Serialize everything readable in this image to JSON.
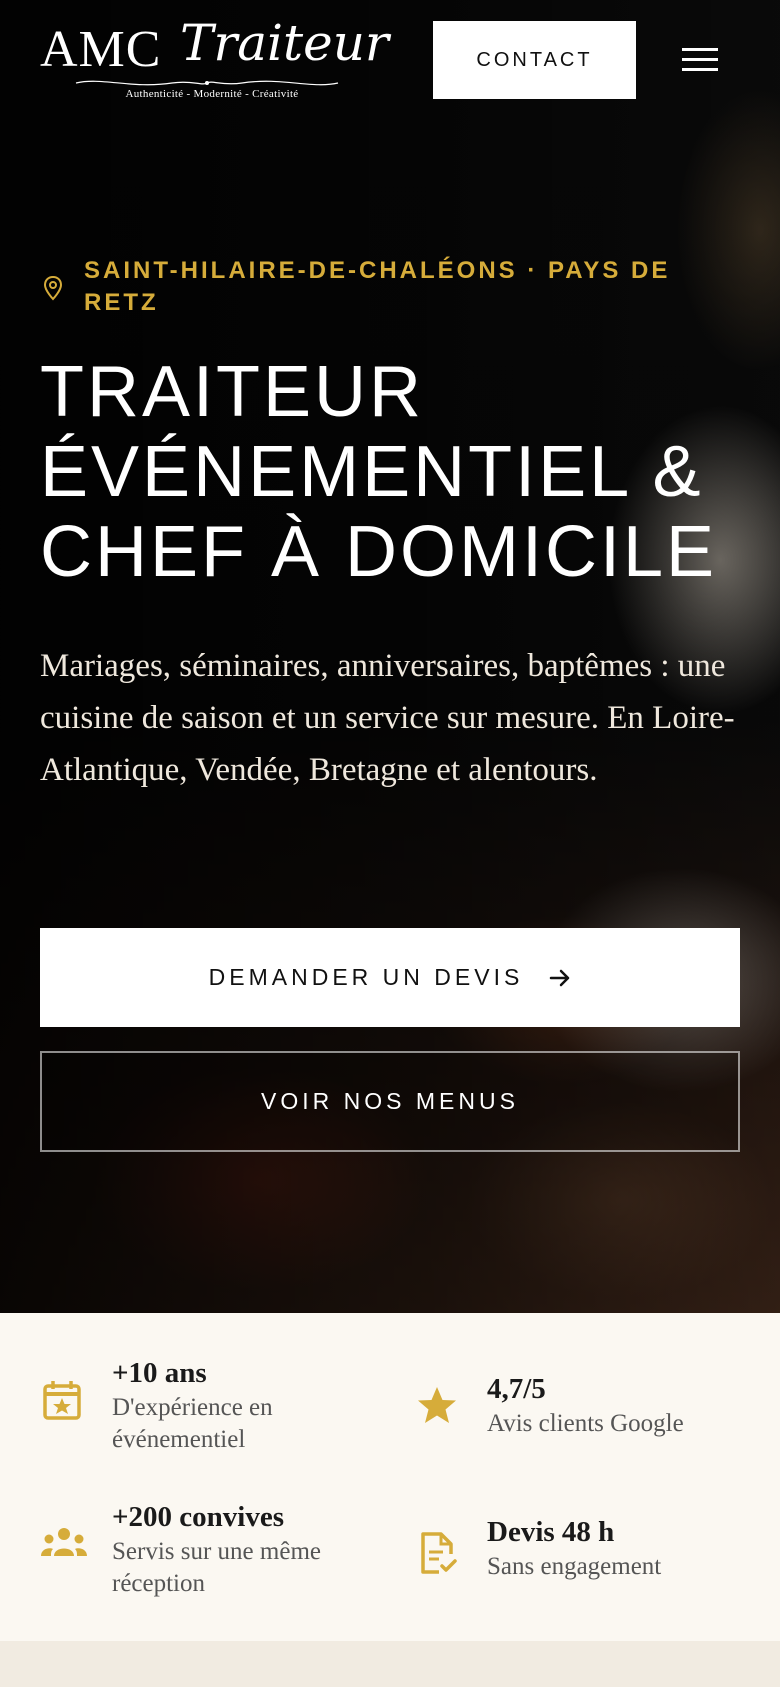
{
  "header": {
    "logo": {
      "brand": "AMC",
      "name": "Traiteur",
      "tagline": "Authenticité - Modernité - Créativité"
    },
    "contact_label": "CONTACT",
    "menu_icon": "hamburger-menu-icon"
  },
  "hero": {
    "location_icon": "map-pin-icon",
    "location": "SAINT-HILAIRE-DE-CHALÉONS · PAYS DE RETZ",
    "title": "TRAITEUR ÉVÉNEMENTIEL & CHEF À DOMICILE",
    "description": "Mariages, séminaires, anniversaires, baptêmes : une cuisine de saison et un service sur mesure. En Loire-Atlantique, Vendée, Bretagne et alentours.",
    "cta_primary": "DEMANDER UN DEVIS",
    "cta_primary_icon": "arrow-right-icon",
    "cta_secondary": "VOIR NOS MENUS"
  },
  "stats": [
    {
      "icon": "calendar-star-icon",
      "value": "+10 ans",
      "label": "D'expérience en événementiel"
    },
    {
      "icon": "star-icon",
      "value": "4,7/5",
      "label": "Avis clients Google"
    },
    {
      "icon": "group-icon",
      "value": "+200 convives",
      "label": "Servis sur une même réception"
    },
    {
      "icon": "document-check-icon",
      "value": "Devis 48 h",
      "label": "Sans engagement"
    }
  ],
  "colors": {
    "accent": "#d6ac3a",
    "hero_bg": "#0b0b0b",
    "stats_bg": "#fbf8f2",
    "white": "#ffffff"
  }
}
